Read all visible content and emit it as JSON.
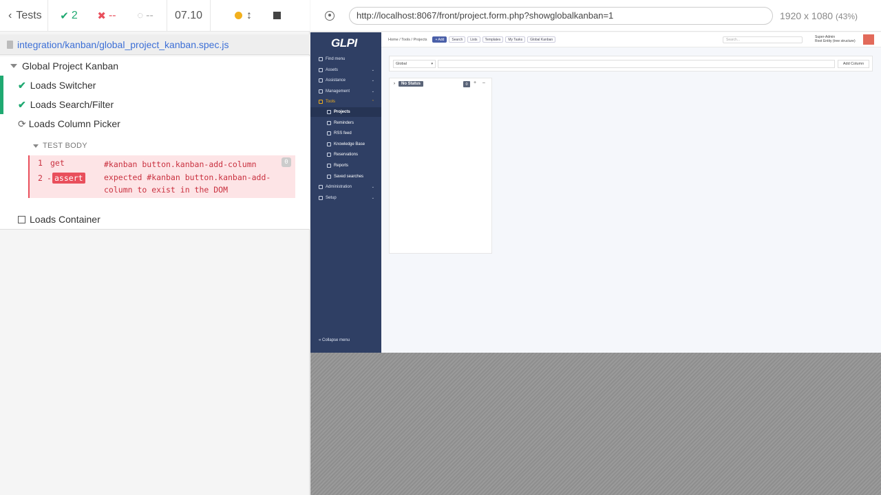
{
  "reporter": {
    "tests_label": "Tests",
    "passed": "2",
    "failed": "--",
    "pending": "--",
    "duration": "07.10",
    "spec_path": "integration/kanban/global_project_kanban.spec.js",
    "suite_title": "Global Project Kanban",
    "tests": [
      {
        "title": "Loads Switcher",
        "state": "passed"
      },
      {
        "title": "Loads Search/Filter",
        "state": "passed"
      },
      {
        "title": "Loads Column Picker",
        "state": "running"
      },
      {
        "title": "Loads Container",
        "state": "pending"
      }
    ],
    "test_body_label": "TEST BODY",
    "commands": [
      {
        "num": "1",
        "name": "get",
        "message": "#kanban button.kanban-add-column",
        "badge": "0"
      },
      {
        "num": "2",
        "prefix": "-",
        "name": "assert",
        "message": "expected #kanban button.kanban-add-column to exist in the DOM"
      }
    ]
  },
  "aut": {
    "url": "http://localhost:8067/front/project.form.php?showglobalkanban=1",
    "viewport": "1920 x 1080",
    "scale": "(43%)"
  },
  "glpi": {
    "logo": "GLPI",
    "menu": [
      {
        "label": "Find menu"
      },
      {
        "label": "Assets"
      },
      {
        "label": "Assistance"
      },
      {
        "label": "Management"
      },
      {
        "label": "Tools"
      },
      {
        "label": "Projects"
      },
      {
        "label": "Reminders"
      },
      {
        "label": "RSS feed"
      },
      {
        "label": "Knowledge Base"
      },
      {
        "label": "Reservations"
      },
      {
        "label": "Reports"
      },
      {
        "label": "Saved searches"
      },
      {
        "label": "Administration"
      },
      {
        "label": "Setup"
      }
    ],
    "collapse_label": "Collapse menu",
    "breadcrumb": [
      "Home",
      "Tools",
      "Projects"
    ],
    "toolbar": [
      "+ Add",
      "Search",
      "Lists",
      "Templates",
      "My Tasks",
      "Global Kanban"
    ],
    "search_placeholder": "Search...",
    "user_name": "Super-Admin",
    "user_entity": "Root Entity (tree structure)",
    "filter_select": "Global",
    "add_column": "Add Column",
    "column_title": "No Status",
    "column_count": "0",
    "colors": {
      "sidebar": "#2f3f64",
      "accent": "#f2b01e",
      "pass": "#1fa971",
      "fail": "#e94f5c"
    }
  }
}
